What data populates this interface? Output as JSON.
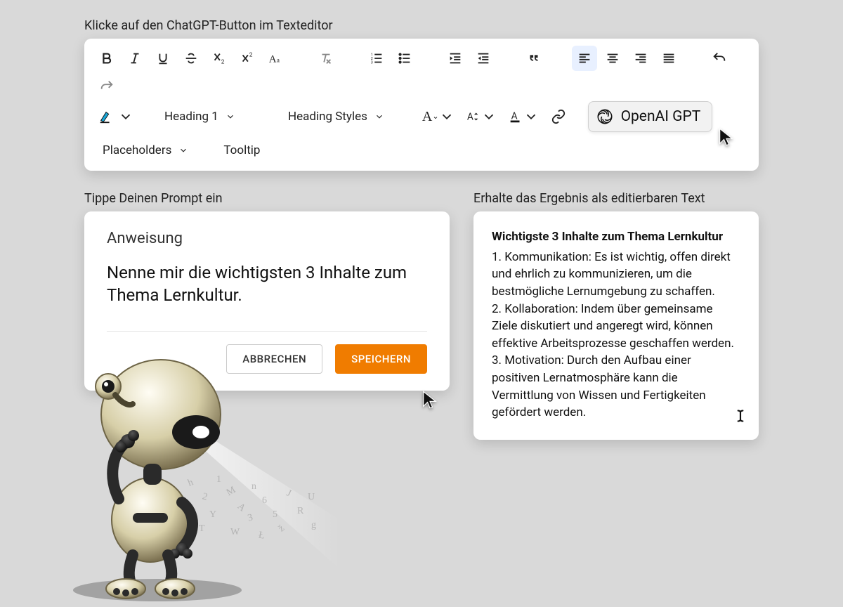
{
  "toolbar_caption": "Klicke auf den ChatGPT-Button im Texteditor",
  "toolbar": {
    "heading_dd": "Heading 1",
    "heading_styles_dd": "Heading Styles",
    "placeholders_dd": "Placeholders",
    "tooltip_dd": "Tooltip",
    "gpt_label": "OpenAI GPT"
  },
  "prompt_caption": "Tippe Deinen Prompt ein",
  "prompt": {
    "title": "Anweisung",
    "text": "Nenne mir die wichtigsten 3 Inhalte zum Thema Lernkultur.",
    "cancel": "ABBRECHEN",
    "save": "SPEICHERN"
  },
  "result_caption": "Erhalte das Ergebnis als editierbaren Text",
  "result": {
    "title": "Wichtigste 3 Inhalte zum Thema Lernkultur",
    "items": [
      "1. Kommunikation: Es ist wichtig, offen direkt und ehrlich zu kommunizieren, um die bestmögliche Lernumgebung zu schaffen.",
      "2. Kollaboration: Indem über gemeinsame Ziele diskutiert und angeregt wird, können effektive Arbeitsprozesse geschaffen werden.",
      "3. Motivation: Durch den Aufbau einer positiven Lernatmosphäre kann die Vermittlung von Wissen und Fertigkeiten gefördert werden."
    ]
  }
}
